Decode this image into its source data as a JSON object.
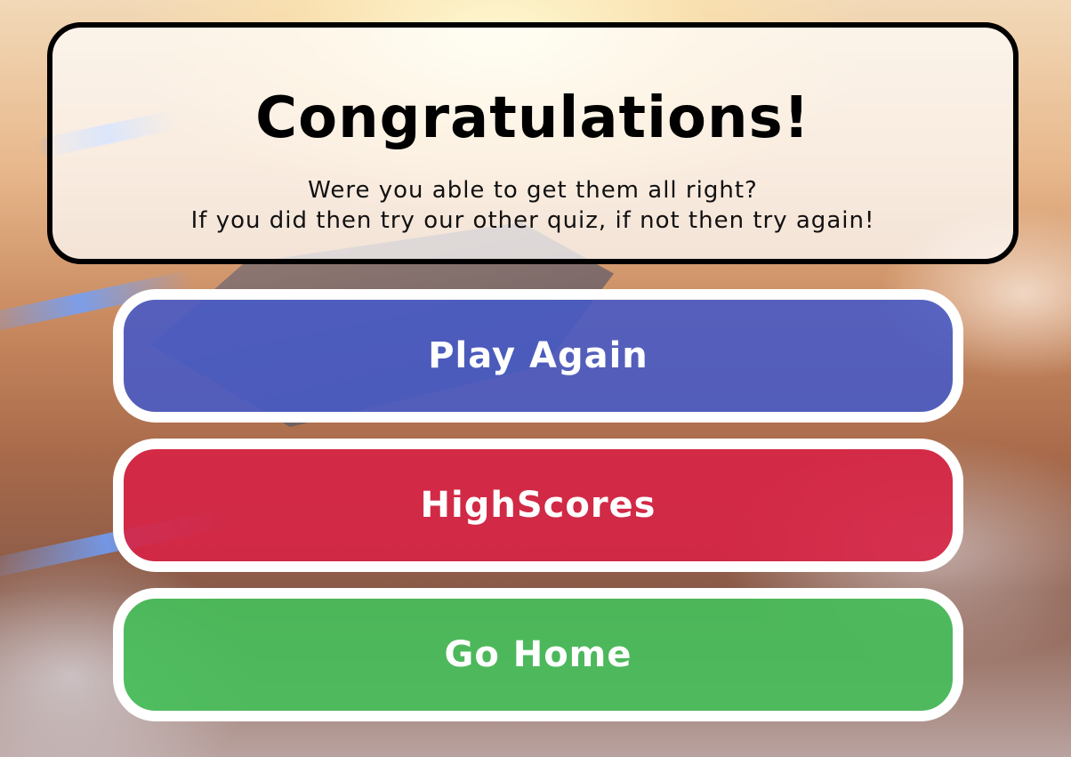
{
  "dialog": {
    "title": "Congratulations!",
    "message_line1": "Were you able to get them all right?",
    "message_line2": "If you did then try our other quiz, if not then try again!"
  },
  "buttons": {
    "play_again": "Play Again",
    "highscores": "HighScores",
    "go_home": "Go Home"
  },
  "colors": {
    "play_again": "#4a5cc8",
    "highscores": "#d62449",
    "go_home": "#48be5c",
    "panel_border": "#000000",
    "button_border": "#ffffff"
  }
}
